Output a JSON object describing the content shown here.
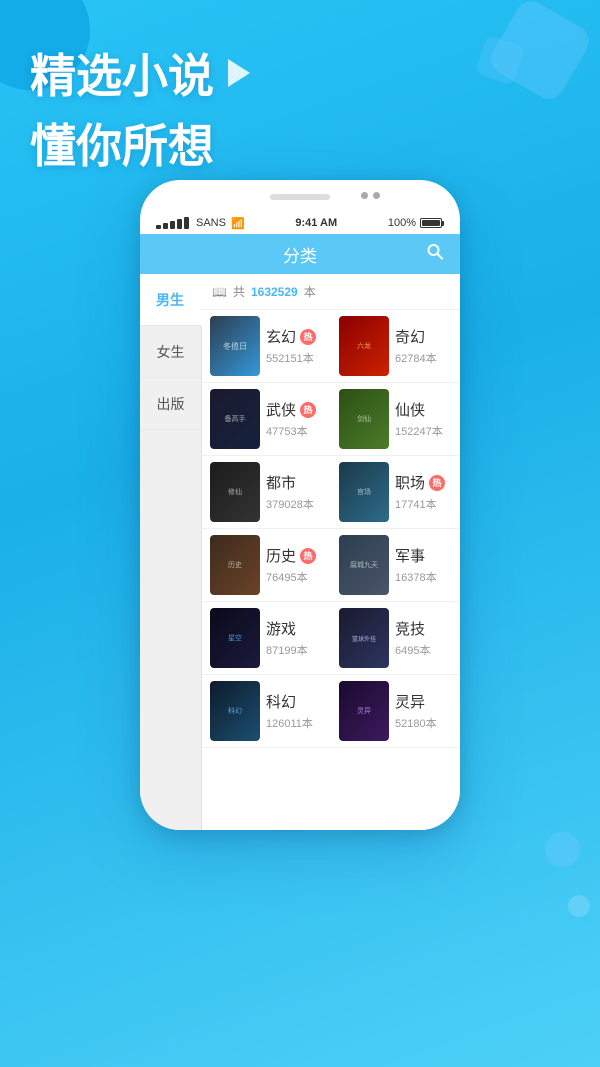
{
  "background": {
    "color": "#29c4f6"
  },
  "hero": {
    "title1": "精选小说",
    "title2": "懂你所想"
  },
  "phone": {
    "status": {
      "carrier": "SANS",
      "time": "9:41 AM",
      "battery": "100%"
    },
    "nav": {
      "title": "分类",
      "search_icon": "search"
    },
    "sidebar": {
      "items": [
        {
          "label": "男生",
          "active": true
        },
        {
          "label": "女生",
          "active": false
        },
        {
          "label": "出版",
          "active": false
        }
      ]
    },
    "filter": {
      "book_icon": "📖",
      "label": "共",
      "count": "1632529",
      "unit": "本"
    },
    "categories": [
      {
        "left": {
          "name": "玄幻",
          "count": "552151本",
          "hot": true,
          "cover_class": "cover-xuanhuan"
        },
        "right": {
          "name": "奇幻",
          "count": "62784本",
          "hot": false,
          "cover_class": "cover-qihuan"
        }
      },
      {
        "left": {
          "name": "武侠",
          "count": "47753本",
          "hot": true,
          "cover_class": "cover-wuxia"
        },
        "right": {
          "name": "仙侠",
          "count": "152247本",
          "hot": false,
          "cover_class": "cover-xianxia"
        }
      },
      {
        "left": {
          "name": "都市",
          "count": "379028本",
          "hot": false,
          "cover_class": "cover-dushi"
        },
        "right": {
          "name": "职场",
          "count": "17741本",
          "hot": true,
          "cover_class": "cover-zhichang"
        }
      },
      {
        "left": {
          "name": "历史",
          "count": "76495本",
          "hot": true,
          "cover_class": "cover-lishi"
        },
        "right": {
          "name": "军事",
          "count": "16378本",
          "hot": false,
          "cover_class": "cover-junshi"
        }
      },
      {
        "left": {
          "name": "游戏",
          "count": "87199本",
          "hot": false,
          "cover_class": "cover-youxi"
        },
        "right": {
          "name": "竞技",
          "count": "6495本",
          "hot": false,
          "cover_class": "cover-jingji"
        }
      },
      {
        "left": {
          "name": "科幻",
          "count": "126011本",
          "hot": false,
          "cover_class": "cover-keji"
        },
        "right": {
          "name": "灵异",
          "count": "52180本",
          "hot": false,
          "cover_class": "cover-lingyi"
        }
      }
    ]
  }
}
